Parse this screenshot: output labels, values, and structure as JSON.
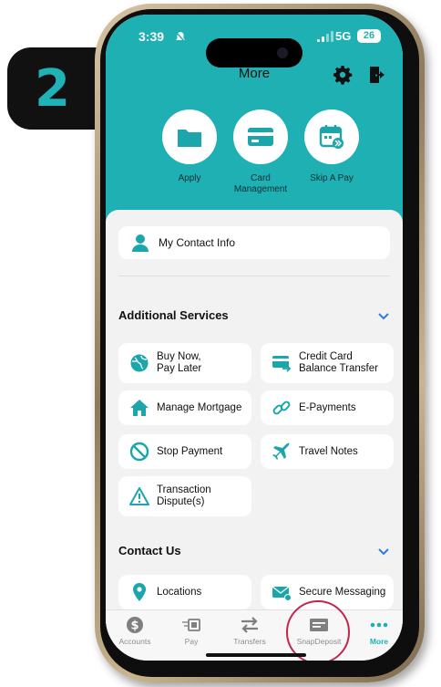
{
  "step": "2",
  "status_bar": {
    "time": "3:39",
    "network": "5G",
    "battery": "26"
  },
  "header": {
    "title": "More"
  },
  "quick_actions": [
    {
      "label": "Apply",
      "icon": "folder-icon"
    },
    {
      "label": "Card Management",
      "icon": "credit-card-icon"
    },
    {
      "label": "Skip A Pay",
      "icon": "calendar-skip-icon"
    }
  ],
  "contact_info": {
    "label": "My Contact Info"
  },
  "additional_services": {
    "title": "Additional Services",
    "items": [
      {
        "label": "Buy Now, Pay Later",
        "line1": "Buy Now,",
        "line2": "Pay Later"
      },
      {
        "label": "Credit Card Balance Transfer",
        "line1": "Credit Card",
        "line2": "Balance Transfer"
      },
      {
        "label": "Manage Mortgage"
      },
      {
        "label": "E-Payments"
      },
      {
        "label": "Stop Payment"
      },
      {
        "label": "Travel Notes"
      },
      {
        "label": "Transaction Dispute(s)",
        "line1": "Transaction",
        "line2": "Dispute(s)"
      }
    ]
  },
  "contact_us": {
    "title": "Contact Us",
    "items": [
      {
        "label": "Locations"
      },
      {
        "label": "Secure Messaging"
      }
    ]
  },
  "tabs": [
    {
      "label": "Accounts"
    },
    {
      "label": "Pay"
    },
    {
      "label": "Transfers"
    },
    {
      "label": "SnapDeposit"
    },
    {
      "label": "More",
      "active": true
    }
  ],
  "colors": {
    "accent": "#1fb0b4",
    "highlight": "#c2264e",
    "text": "#111111",
    "sheet": "#f2f2f3"
  }
}
